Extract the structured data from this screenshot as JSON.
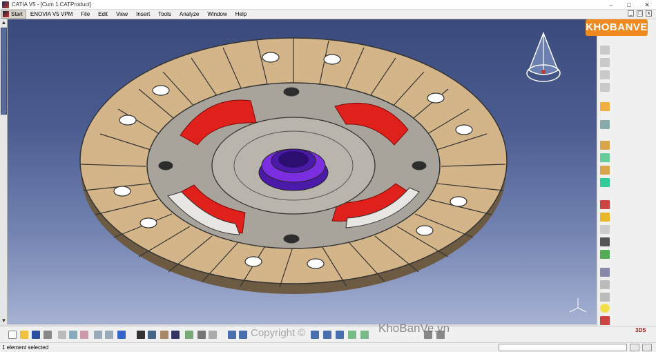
{
  "window": {
    "title": "CATIA V5 - [Cum 1.CATProduct]"
  },
  "menu": {
    "start": "Start",
    "items": [
      "ENOVIA V5 VPM",
      "File",
      "Edit",
      "View",
      "Insert",
      "Tools",
      "Analyze",
      "Window",
      "Help"
    ]
  },
  "logo": {
    "text": "KHOBANVE"
  },
  "watermarks": {
    "left": "Copyright ©",
    "right": "KhoBanVe.vn"
  },
  "status": {
    "message": "1 element selected"
  },
  "colors": {
    "background_top": "#3a4a7c",
    "background_bottom": "#a7b2d3",
    "friction_lining": "#d4b58a",
    "hub": "#7a2ee0",
    "springs": "#e0201a",
    "logo": "#f08a1e"
  },
  "right_toolbar_icons": [
    "product-icon",
    "part-icon",
    "component-icon",
    "update-icon",
    "select-icon",
    "fly-icon",
    "constraint-icon",
    "move-icon",
    "snap-icon",
    "explode-icon",
    "clash-icon",
    "section-icon",
    "measure-icon",
    "annotation-icon",
    "bom-icon",
    "publication-icon",
    "scene-icon",
    "catalog-icon",
    "light-icon",
    "mirror-icon"
  ],
  "bottom_toolbar_icons": [
    "new-icon",
    "open-icon",
    "save-icon",
    "print-icon",
    "cut-icon",
    "copy-icon",
    "paste-icon",
    "undo-icon",
    "redo-icon",
    "whats-this-icon",
    "formula-icon",
    "comment-icon",
    "knowledge-icon",
    "table-icon",
    "measure-icon",
    "shading-icon",
    "fit-all-icon",
    "pan-icon",
    "rotate-icon",
    "zoom-in-icon",
    "zoom-out-icon",
    "normal-view-icon",
    "view-icon",
    "render-icon",
    "hide-show-icon",
    "swap-icon"
  ]
}
